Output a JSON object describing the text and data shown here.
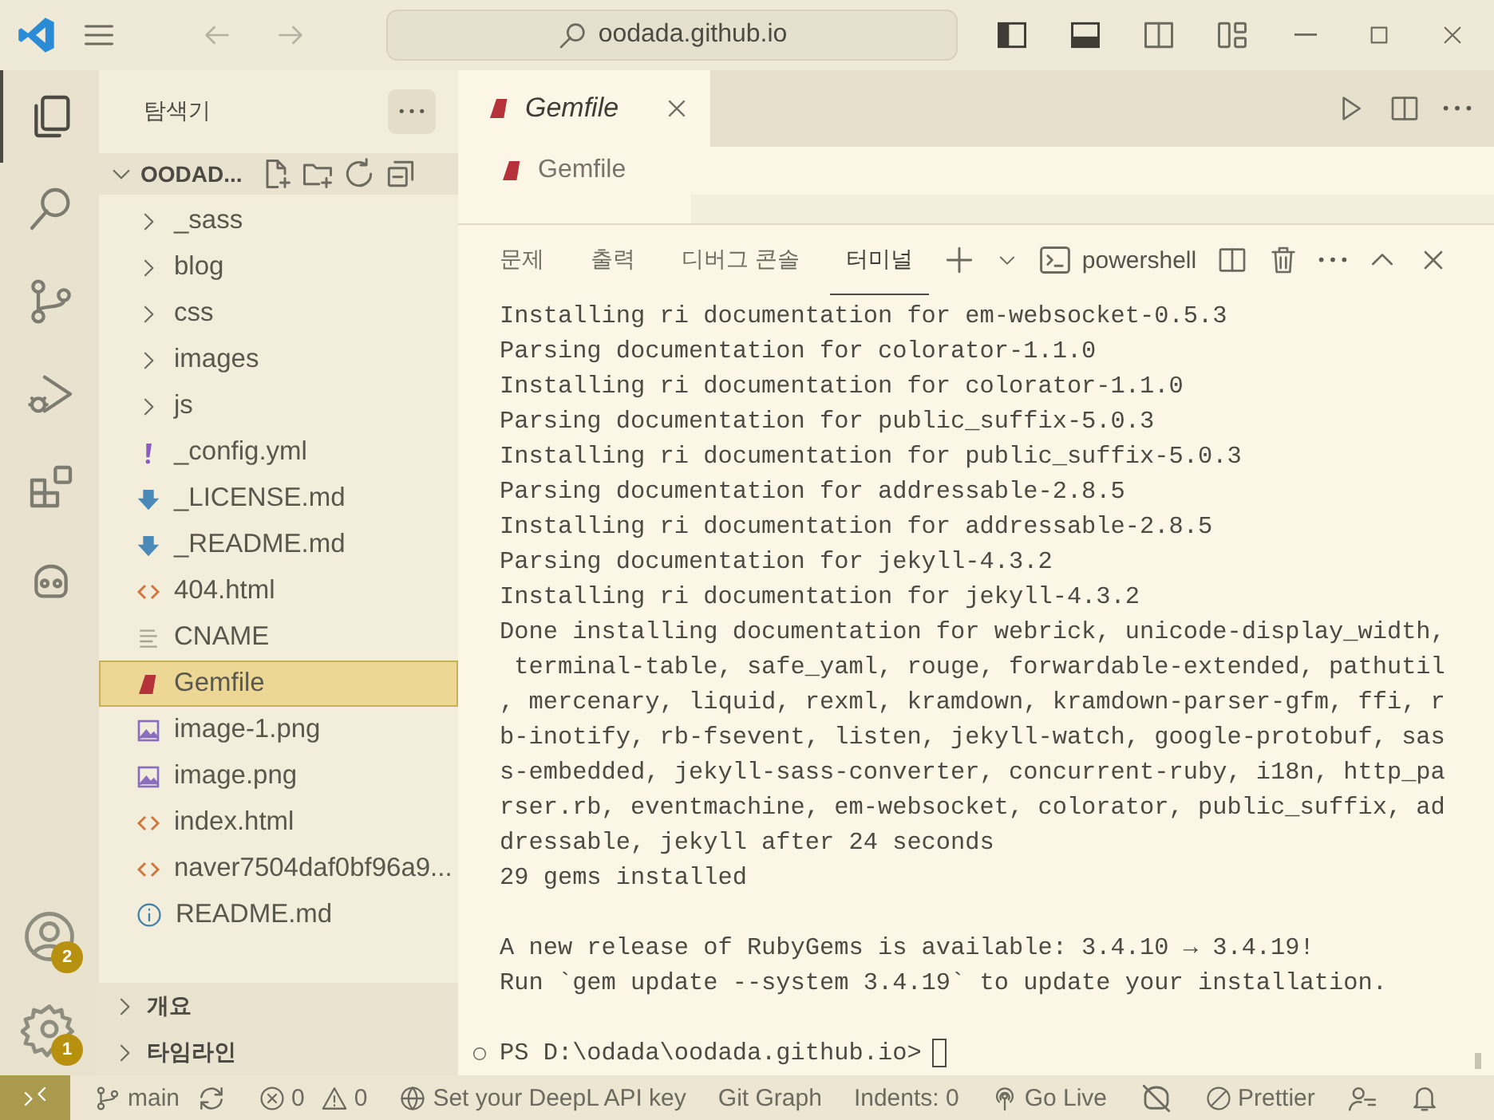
{
  "title_bar": {
    "search": "oodada.github.io"
  },
  "activity_bar": {
    "items": [
      {
        "kind": "explorer",
        "selected": true
      },
      {
        "kind": "search",
        "selected": false
      },
      {
        "kind": "source-control",
        "selected": false
      },
      {
        "kind": "run-debug",
        "selected": false
      },
      {
        "kind": "extensions",
        "selected": false
      },
      {
        "kind": "robot",
        "selected": false
      }
    ],
    "bottom": [
      {
        "kind": "account",
        "badge": "2"
      },
      {
        "kind": "settings",
        "badge": "1"
      }
    ]
  },
  "sidebar": {
    "title": "탐색기",
    "folder": {
      "name": "OODAD...",
      "expanded": true
    },
    "items": [
      {
        "name": "_sass",
        "kind": "folder",
        "selected": false
      },
      {
        "name": "blog",
        "kind": "folder",
        "selected": false
      },
      {
        "name": "css",
        "kind": "folder",
        "selected": false
      },
      {
        "name": "images",
        "kind": "folder",
        "selected": false
      },
      {
        "name": "js",
        "kind": "folder",
        "selected": false
      },
      {
        "name": "_config.yml",
        "kind": "yaml",
        "selected": false
      },
      {
        "name": "_LICENSE.md",
        "kind": "markdown",
        "selected": false
      },
      {
        "name": "_README.md",
        "kind": "markdown",
        "selected": false
      },
      {
        "name": "404.html",
        "kind": "html",
        "selected": false
      },
      {
        "name": "CNAME",
        "kind": "text",
        "selected": false
      },
      {
        "name": "Gemfile",
        "kind": "ruby",
        "selected": true
      },
      {
        "name": "image-1.png",
        "kind": "image",
        "selected": false
      },
      {
        "name": "image.png",
        "kind": "image",
        "selected": false
      },
      {
        "name": "index.html",
        "kind": "html",
        "selected": false
      },
      {
        "name": "naver7504daf0bf96a9...",
        "kind": "html",
        "selected": false
      },
      {
        "name": "README.md",
        "kind": "info",
        "selected": false
      }
    ],
    "sections": [
      {
        "title": "개요",
        "expanded": false
      },
      {
        "title": "타임라인",
        "expanded": false
      }
    ]
  },
  "editor": {
    "tabs": [
      {
        "label": "Gemfile",
        "selected": true
      }
    ],
    "breadcrumb": "Gemfile"
  },
  "panel": {
    "tabs": [
      {
        "label": "문제",
        "selected": false
      },
      {
        "label": "출력",
        "selected": false
      },
      {
        "label": "디버그 콘솔",
        "selected": false
      },
      {
        "label": "터미널",
        "selected": true
      }
    ],
    "shell": "powershell",
    "blocks": [
      [
        "Installing ri documentation for em-websocket-0.5.3",
        "Parsing documentation for colorator-1.1.0",
        "Installing ri documentation for colorator-1.1.0",
        "Parsing documentation for public_suffix-5.0.3",
        "Installing ri documentation for public_suffix-5.0.3",
        "Parsing documentation for addressable-2.8.5",
        "Installing ri documentation for addressable-2.8.5",
        "Parsing documentation for jekyll-4.3.2",
        "Installing ri documentation for jekyll-4.3.2",
        "Done installing documentation for webrick, unicode-display_width,",
        " terminal-table, safe_yaml, rouge, forwardable-extended, pathutil",
        ", mercenary, liquid, rexml, kramdown, kramdown-parser-gfm, ffi, r",
        "b-inotify, rb-fsevent, listen, jekyll-watch, google-protobuf, sas",
        "s-embedded, jekyll-sass-converter, concurrent-ruby, i18n, http_pa",
        "rser.rb, eventmachine, em-websocket, colorator, public_suffix, ad",
        "dressable, jekyll after 24 seconds",
        "29 gems installed"
      ],
      [
        "A new release of RubyGems is available: 3.4.10 → 3.4.19!",
        "Run `gem update --system 3.4.19` to update your installation."
      ]
    ],
    "prompt": "PS D:\\odada\\oodada.github.io>"
  },
  "status_bar": {
    "remote": true,
    "items": [
      {
        "kind": "branch",
        "text": "main"
      },
      {
        "kind": "sync"
      },
      {
        "kind": "errors",
        "text": "0"
      },
      {
        "kind": "warnings",
        "text": "0"
      },
      {
        "kind": "globe",
        "text": "Set your DeepL API key"
      },
      {
        "kind": "plain",
        "text": "Git Graph"
      },
      {
        "kind": "plain",
        "text": "Indents: 0"
      },
      {
        "kind": "broadcast",
        "text": "Go Live"
      },
      {
        "kind": "copilot"
      },
      {
        "kind": "prettier",
        "text": "Prettier"
      },
      {
        "kind": "feedback"
      },
      {
        "kind": "bell"
      }
    ]
  }
}
